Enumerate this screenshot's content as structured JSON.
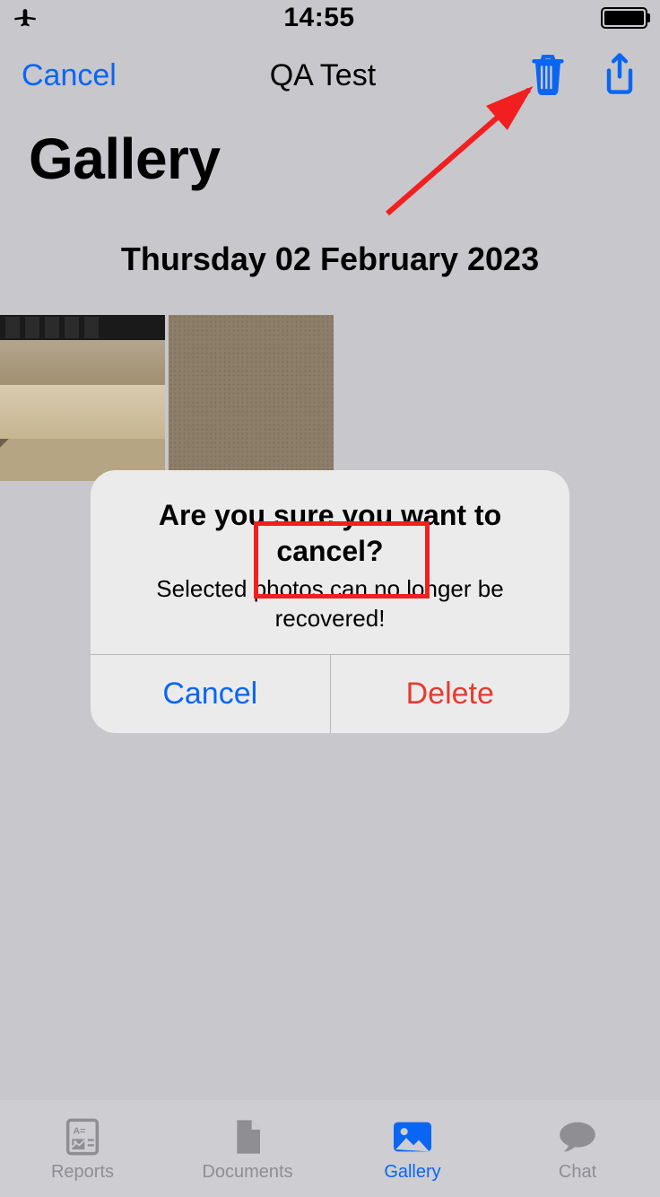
{
  "status": {
    "time": "14:55"
  },
  "nav": {
    "cancel_label": "Cancel",
    "title": "QA Test"
  },
  "page": {
    "large_title": "Gallery",
    "date_header": "Thursday 02 February 2023"
  },
  "dialog": {
    "title": "Are you sure you want to cancel?",
    "message": "Selected photos can no longer be recovered!",
    "cancel_label": "Cancel",
    "delete_label": "Delete"
  },
  "tabs": [
    {
      "label": "Reports"
    },
    {
      "label": "Documents"
    },
    {
      "label": "Gallery"
    },
    {
      "label": "Chat"
    }
  ],
  "colors": {
    "tint": "#0a66f2",
    "destructive": "#e63b2e",
    "annotation": "#f11f1f"
  }
}
